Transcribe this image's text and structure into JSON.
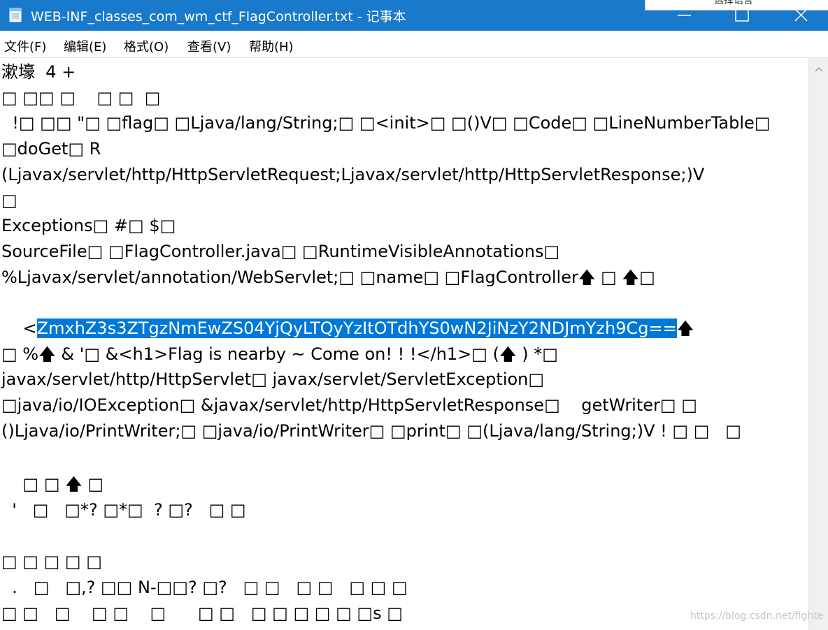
{
  "window": {
    "title": "WEB-INF_classes_com_wm_ctf_FlagController.txt - 记事本",
    "app_icon": "notepad-icon",
    "ime_hint": "选择语言",
    "buttons": [
      "minimize-icon",
      "maximize-icon",
      "close-icon"
    ]
  },
  "menu": {
    "items": [
      "文件(F)",
      "编辑(E)",
      "格式(O)",
      "查看(V)",
      "帮助(H)"
    ]
  },
  "editor": {
    "lines": [
      "漱壕  4 +",
      "□ □□ □    □ □  □",
      "  !□ □□ \"□ □flag□ □Ljava/lang/String;□ □<init>□ □()V□ □Code□ □LineNumberTable□",
      "□doGet□ R",
      "(Ljavax/servlet/http/HttpServletRequest;Ljavax/servlet/http/HttpServletResponse;)V",
      "□",
      "Exceptions□ #□ $□",
      "SourceFile□ □FlagController.java□ □RuntimeVisibleAnnotations□",
      "%Ljavax/servlet/annotation/WebServlet;□ □name□ □FlagController🡅 □ 🡅□",
      "",
      "",
      "□ %🡅 & '□ &<h1>Flag is nearby ~ Come on! ! !</h1>□ (🡅 ) *□",
      "javax/servlet/http/HttpServlet□ javax/servlet/ServletException□",
      "□java/io/IOException□ &javax/servlet/http/HttpServletResponse□    getWriter□ □",
      "()Ljava/io/PrintWriter;□ □java/io/PrintWriter□ □print□ □(Ljava/lang/String;)V ! □ □   □",
      "",
      "",
      "    □ □ 🡅 □",
      "  '   □   □*? □*□  ? □?   □ □",
      "",
      "",
      "□ □ □ □ □",
      "  .   □   □,? □□ N-□□? □?   □ □   □ □   □ □ □",
      "□ □   □    □ □    □      □ □   □ □ □ □ □ □s □"
    ],
    "selection_line": {
      "prefix": "<",
      "selected": "ZmxhZ3s3ZTgzNmEwZS04YjQyLTQyYzItOTdhYS0wN2JiNzY2NDJmYzh9Cg==",
      "suffix": "🡅"
    },
    "selection_color": "#0078d7"
  },
  "scrollbar": {
    "up_icon": "scroll-up-arrow-icon"
  },
  "watermark": "https://blog.csdn.net/fighte",
  "colors": {
    "titlebar": "#1979ca",
    "selection": "#0078d7"
  }
}
